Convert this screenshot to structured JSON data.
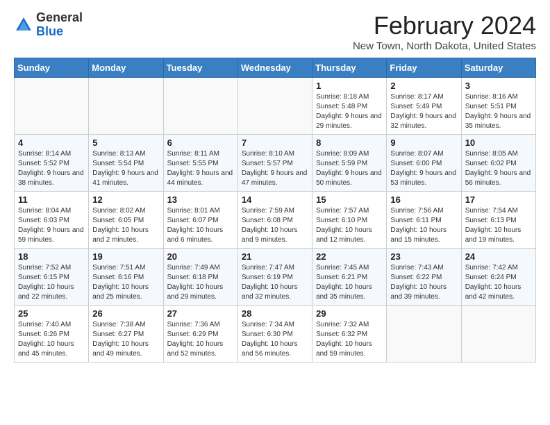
{
  "header": {
    "logo_general": "General",
    "logo_blue": "Blue",
    "month": "February 2024",
    "location": "New Town, North Dakota, United States"
  },
  "days_of_week": [
    "Sunday",
    "Monday",
    "Tuesday",
    "Wednesday",
    "Thursday",
    "Friday",
    "Saturday"
  ],
  "weeks": [
    [
      {
        "day": "",
        "sunrise": "",
        "sunset": "",
        "daylight": ""
      },
      {
        "day": "",
        "sunrise": "",
        "sunset": "",
        "daylight": ""
      },
      {
        "day": "",
        "sunrise": "",
        "sunset": "",
        "daylight": ""
      },
      {
        "day": "",
        "sunrise": "",
        "sunset": "",
        "daylight": ""
      },
      {
        "day": "1",
        "sunrise": "Sunrise: 8:18 AM",
        "sunset": "Sunset: 5:48 PM",
        "daylight": "Daylight: 9 hours and 29 minutes."
      },
      {
        "day": "2",
        "sunrise": "Sunrise: 8:17 AM",
        "sunset": "Sunset: 5:49 PM",
        "daylight": "Daylight: 9 hours and 32 minutes."
      },
      {
        "day": "3",
        "sunrise": "Sunrise: 8:16 AM",
        "sunset": "Sunset: 5:51 PM",
        "daylight": "Daylight: 9 hours and 35 minutes."
      }
    ],
    [
      {
        "day": "4",
        "sunrise": "Sunrise: 8:14 AM",
        "sunset": "Sunset: 5:52 PM",
        "daylight": "Daylight: 9 hours and 38 minutes."
      },
      {
        "day": "5",
        "sunrise": "Sunrise: 8:13 AM",
        "sunset": "Sunset: 5:54 PM",
        "daylight": "Daylight: 9 hours and 41 minutes."
      },
      {
        "day": "6",
        "sunrise": "Sunrise: 8:11 AM",
        "sunset": "Sunset: 5:55 PM",
        "daylight": "Daylight: 9 hours and 44 minutes."
      },
      {
        "day": "7",
        "sunrise": "Sunrise: 8:10 AM",
        "sunset": "Sunset: 5:57 PM",
        "daylight": "Daylight: 9 hours and 47 minutes."
      },
      {
        "day": "8",
        "sunrise": "Sunrise: 8:09 AM",
        "sunset": "Sunset: 5:59 PM",
        "daylight": "Daylight: 9 hours and 50 minutes."
      },
      {
        "day": "9",
        "sunrise": "Sunrise: 8:07 AM",
        "sunset": "Sunset: 6:00 PM",
        "daylight": "Daylight: 9 hours and 53 minutes."
      },
      {
        "day": "10",
        "sunrise": "Sunrise: 8:05 AM",
        "sunset": "Sunset: 6:02 PM",
        "daylight": "Daylight: 9 hours and 56 minutes."
      }
    ],
    [
      {
        "day": "11",
        "sunrise": "Sunrise: 8:04 AM",
        "sunset": "Sunset: 6:03 PM",
        "daylight": "Daylight: 9 hours and 59 minutes."
      },
      {
        "day": "12",
        "sunrise": "Sunrise: 8:02 AM",
        "sunset": "Sunset: 6:05 PM",
        "daylight": "Daylight: 10 hours and 2 minutes."
      },
      {
        "day": "13",
        "sunrise": "Sunrise: 8:01 AM",
        "sunset": "Sunset: 6:07 PM",
        "daylight": "Daylight: 10 hours and 6 minutes."
      },
      {
        "day": "14",
        "sunrise": "Sunrise: 7:59 AM",
        "sunset": "Sunset: 6:08 PM",
        "daylight": "Daylight: 10 hours and 9 minutes."
      },
      {
        "day": "15",
        "sunrise": "Sunrise: 7:57 AM",
        "sunset": "Sunset: 6:10 PM",
        "daylight": "Daylight: 10 hours and 12 minutes."
      },
      {
        "day": "16",
        "sunrise": "Sunrise: 7:56 AM",
        "sunset": "Sunset: 6:11 PM",
        "daylight": "Daylight: 10 hours and 15 minutes."
      },
      {
        "day": "17",
        "sunrise": "Sunrise: 7:54 AM",
        "sunset": "Sunset: 6:13 PM",
        "daylight": "Daylight: 10 hours and 19 minutes."
      }
    ],
    [
      {
        "day": "18",
        "sunrise": "Sunrise: 7:52 AM",
        "sunset": "Sunset: 6:15 PM",
        "daylight": "Daylight: 10 hours and 22 minutes."
      },
      {
        "day": "19",
        "sunrise": "Sunrise: 7:51 AM",
        "sunset": "Sunset: 6:16 PM",
        "daylight": "Daylight: 10 hours and 25 minutes."
      },
      {
        "day": "20",
        "sunrise": "Sunrise: 7:49 AM",
        "sunset": "Sunset: 6:18 PM",
        "daylight": "Daylight: 10 hours and 29 minutes."
      },
      {
        "day": "21",
        "sunrise": "Sunrise: 7:47 AM",
        "sunset": "Sunset: 6:19 PM",
        "daylight": "Daylight: 10 hours and 32 minutes."
      },
      {
        "day": "22",
        "sunrise": "Sunrise: 7:45 AM",
        "sunset": "Sunset: 6:21 PM",
        "daylight": "Daylight: 10 hours and 35 minutes."
      },
      {
        "day": "23",
        "sunrise": "Sunrise: 7:43 AM",
        "sunset": "Sunset: 6:22 PM",
        "daylight": "Daylight: 10 hours and 39 minutes."
      },
      {
        "day": "24",
        "sunrise": "Sunrise: 7:42 AM",
        "sunset": "Sunset: 6:24 PM",
        "daylight": "Daylight: 10 hours and 42 minutes."
      }
    ],
    [
      {
        "day": "25",
        "sunrise": "Sunrise: 7:40 AM",
        "sunset": "Sunset: 6:26 PM",
        "daylight": "Daylight: 10 hours and 45 minutes."
      },
      {
        "day": "26",
        "sunrise": "Sunrise: 7:38 AM",
        "sunset": "Sunset: 6:27 PM",
        "daylight": "Daylight: 10 hours and 49 minutes."
      },
      {
        "day": "27",
        "sunrise": "Sunrise: 7:36 AM",
        "sunset": "Sunset: 6:29 PM",
        "daylight": "Daylight: 10 hours and 52 minutes."
      },
      {
        "day": "28",
        "sunrise": "Sunrise: 7:34 AM",
        "sunset": "Sunset: 6:30 PM",
        "daylight": "Daylight: 10 hours and 56 minutes."
      },
      {
        "day": "29",
        "sunrise": "Sunrise: 7:32 AM",
        "sunset": "Sunset: 6:32 PM",
        "daylight": "Daylight: 10 hours and 59 minutes."
      },
      {
        "day": "",
        "sunrise": "",
        "sunset": "",
        "daylight": ""
      },
      {
        "day": "",
        "sunrise": "",
        "sunset": "",
        "daylight": ""
      }
    ]
  ]
}
